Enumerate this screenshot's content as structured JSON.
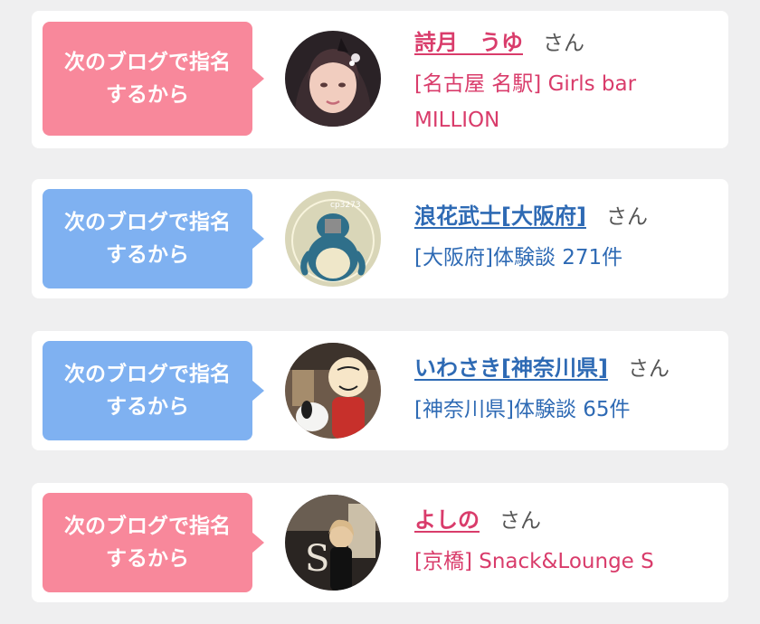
{
  "cards": [
    {
      "bubble_line1": "次のブログで指名",
      "bubble_line2": "するから",
      "name": "詩月　うゆ",
      "honorific": "さん",
      "detail_line1": "[名古屋 名駅] Girls bar",
      "detail_line2": "MILLION",
      "bubble_color": "#f8889b",
      "text_color": "#d93c6b"
    },
    {
      "bubble_line1": "次のブログで指名",
      "bubble_line2": "するから",
      "name": "浪花武士[大阪府]",
      "honorific": "さん",
      "detail_line1": "[大阪府]体験談 271件",
      "avatar_label": "cp3273",
      "bubble_color": "#7fb1f1",
      "text_color": "#2e6ab4"
    },
    {
      "bubble_line1": "次のブログで指名",
      "bubble_line2": "するから",
      "name": "いわさき[神奈川県]",
      "honorific": "さん",
      "detail_line1": "[神奈川県]体験談 65件",
      "bubble_color": "#7fb1f1",
      "text_color": "#2e6ab4"
    },
    {
      "bubble_line1": "次のブログで指名",
      "bubble_line2": "するから",
      "name": "よしの",
      "honorific": "さん",
      "detail_line1": "[京橋] Snack&Lounge S",
      "bubble_color": "#f8889b",
      "text_color": "#d93c6b"
    }
  ]
}
